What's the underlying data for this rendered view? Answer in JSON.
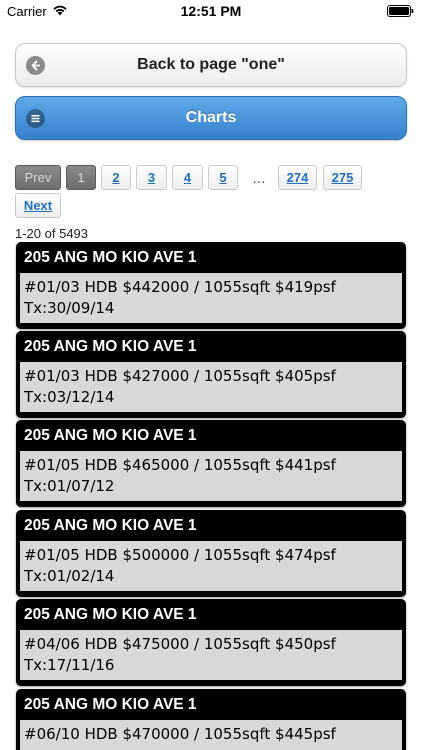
{
  "status_bar": {
    "carrier": "Carrier",
    "time": "12:51 PM"
  },
  "nav": {
    "back_label": "Back to page \"one\"",
    "charts_label": "Charts"
  },
  "pager": {
    "prev": "Prev",
    "pages": [
      "1",
      "2",
      "3",
      "4",
      "5"
    ],
    "current": "1",
    "ellipsis": "…",
    "last_pages": [
      "274",
      "275"
    ],
    "next": "Next"
  },
  "result_count": "1-20 of 5493",
  "listings": [
    {
      "address": "205 ANG MO KIO AVE 1",
      "details": "#01/03 HDB $442000 / 1055sqft $419psf",
      "tx": "Tx:30/09/14"
    },
    {
      "address": "205 ANG MO KIO AVE 1",
      "details": "#01/03 HDB $427000 / 1055sqft $405psf",
      "tx": "Tx:03/12/14"
    },
    {
      "address": "205 ANG MO KIO AVE 1",
      "details": "#01/05 HDB $465000 / 1055sqft $441psf",
      "tx": "Tx:01/07/12"
    },
    {
      "address": "205 ANG MO KIO AVE 1",
      "details": "#01/05 HDB $500000 / 1055sqft $474psf",
      "tx": "Tx:01/02/14"
    },
    {
      "address": "205 ANG MO KIO AVE 1",
      "details": "#04/06 HDB $475000 / 1055sqft $450psf",
      "tx": "Tx:17/11/16"
    },
    {
      "address": "205 ANG MO KIO AVE 1",
      "details": "#06/10 HDB $470000 / 1055sqft $445psf",
      "tx": ""
    }
  ],
  "colors": {
    "accent": "#3782cc",
    "link": "#1f70c1",
    "card": "#000000",
    "card_body": "#d8d8d8"
  }
}
